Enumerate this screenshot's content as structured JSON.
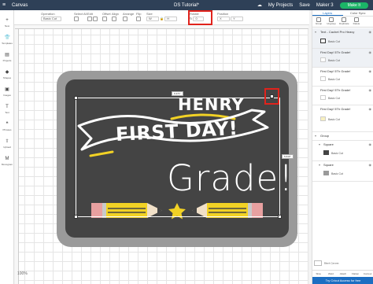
{
  "header": {
    "app_title": "Canvas",
    "doc_title": "DS Tutorial*",
    "projects_label": "My Projects",
    "save_label": "Save",
    "machine_label": "Maker 3",
    "make_label": "Make It"
  },
  "toolbar": {
    "operation_label": "Operation",
    "operation_value": "Basic Cut",
    "select_all_label": "Select All",
    "edit_label": "Edit",
    "offset_label": "Offset",
    "align_label": "Align",
    "arrange_label": "Arrange",
    "flip_label": "Flip",
    "size_label": "Size",
    "w_value": "W",
    "h_value": "H",
    "rotate_label": "Rotate",
    "rotate_value": "0",
    "position_label": "Position",
    "x_value": "X",
    "y_value": "Y"
  },
  "left_sidebar": {
    "items": [
      {
        "label": "New",
        "icon": "plus-icon"
      },
      {
        "label": "Templates",
        "icon": "shirt-icon"
      },
      {
        "label": "Projects",
        "icon": "folder-icon"
      },
      {
        "label": "Shapes",
        "icon": "shapes-icon"
      },
      {
        "label": "Images",
        "icon": "image-icon"
      },
      {
        "label": "Text",
        "icon": "text-icon"
      },
      {
        "label": "Phrases",
        "icon": "quote-icon"
      },
      {
        "label": "Upload",
        "icon": "upload-icon"
      },
      {
        "label": "Monogram",
        "icon": "monogram-icon"
      }
    ]
  },
  "canvas": {
    "henry": "HENRY",
    "first_day": "FIRST DAY!",
    "grade": "Grade!",
    "width_dim": "9.471\"",
    "height_dim": "5.643\""
  },
  "right_panel": {
    "tabs": [
      "Layers",
      "Color Sync"
    ],
    "actions": [
      "Group",
      "Ungroup",
      "Duplicate",
      "Delete"
    ],
    "layers": [
      {
        "name": "Text - Cachet Pro Heavy",
        "sub": "Basic Cut"
      },
      {
        "name": "First Day! 5Th Grade!",
        "sub": "Basic Cut"
      },
      {
        "name": "First Day! 5Th Grade!",
        "sub": "Basic Cut"
      },
      {
        "name": "First Day! 5Th Grade!",
        "sub": "Basic Cut"
      },
      {
        "name": "First Day! 5Th Grade!",
        "sub": "Basic Cut"
      },
      {
        "name": "Group",
        "sub": ""
      },
      {
        "name": "Square",
        "sub": "Basic Cut"
      },
      {
        "name": "Square",
        "sub": "Basic Cut"
      }
    ],
    "blank_canvas": "Blank Canvas",
    "bottom_actions": [
      "Slice",
      "Weld",
      "Attach",
      "Flatten",
      "Contour"
    ],
    "access_label": "Try Cricut Access for free"
  },
  "zoom": "100%",
  "colors": {
    "header": "#2e4057",
    "board": "#444444",
    "frame": "#9a9a9a",
    "accent_yellow": "#f2d225",
    "pencil_pink": "#e8a0a0",
    "highlight_red": "#e0231c",
    "make_green": "#1bb567"
  }
}
